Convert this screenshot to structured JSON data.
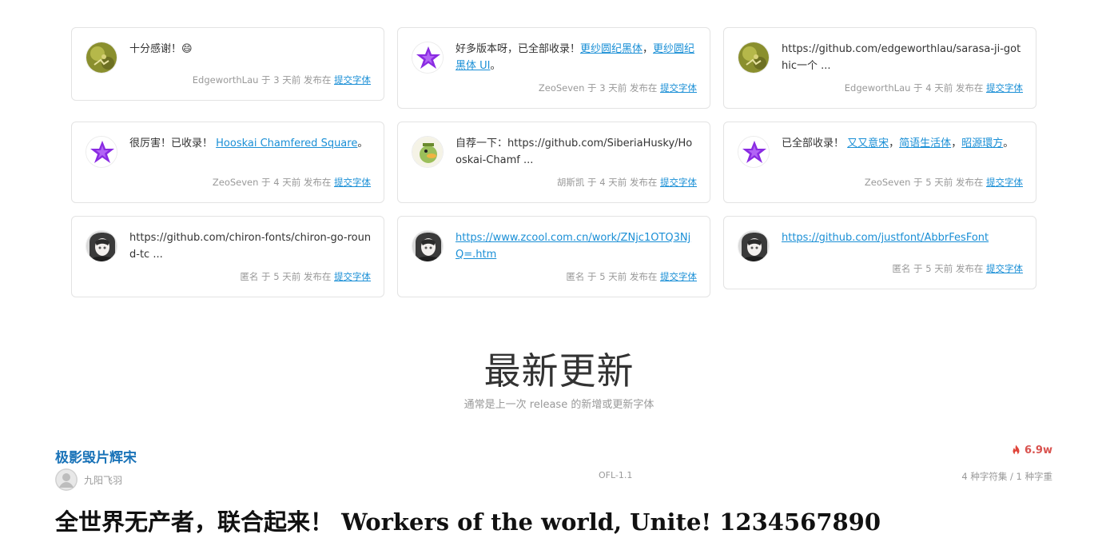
{
  "comments": [
    {
      "avatar": "olive-avatar",
      "message": [
        {
          "text": "十分感谢！😄"
        }
      ],
      "author": "EdgeworthLau",
      "time": "于 3 天前 发布在",
      "link": "提交字体"
    },
    {
      "avatar": "purple-star-avatar",
      "message": [
        {
          "text": "好多版本呀，已全部收录！"
        },
        {
          "text": "更纱圆纪黑体",
          "link": true
        },
        {
          "text": "，"
        },
        {
          "text": "更纱圆纪黑体 UI",
          "link": true
        },
        {
          "text": "。"
        }
      ],
      "author": "ZeoSeven",
      "time": "于 3 天前 发布在",
      "link": "提交字体"
    },
    {
      "avatar": "olive-avatar",
      "message": [
        {
          "text": "https://github.com/edgeworthlau/sarasa-ji-gothic一个 ..."
        }
      ],
      "author": "EdgeworthLau",
      "time": "于 4 天前 发布在",
      "link": "提交字体"
    },
    {
      "avatar": "purple-star-avatar",
      "message": [
        {
          "text": "很厉害！已收录！ "
        },
        {
          "text": "Hooskai Chamfered Square",
          "link": true
        },
        {
          "text": "。"
        }
      ],
      "author": "ZeoSeven",
      "time": "于 4 天前 发布在",
      "link": "提交字体"
    },
    {
      "avatar": "duck-avatar",
      "message": [
        {
          "text": "自荐一下：https://github.com/SiberiaHusky/Hooskai-Chamf ..."
        }
      ],
      "author": "胡斯凯",
      "time": "于 4 天前 发布在",
      "link": "提交字体"
    },
    {
      "avatar": "purple-star-avatar",
      "message": [
        {
          "text": "已全部收录！ "
        },
        {
          "text": "又又意宋",
          "link": true
        },
        {
          "text": "，"
        },
        {
          "text": "简语生活体",
          "link": true
        },
        {
          "text": "，"
        },
        {
          "text": "昭源環方",
          "link": true
        },
        {
          "text": "。"
        }
      ],
      "author": "ZeoSeven",
      "time": "于 5 天前 发布在",
      "link": "提交字体"
    },
    {
      "avatar": "anime-avatar",
      "message": [
        {
          "text": "https://github.com/chiron-fonts/chiron-go-round-tc ..."
        }
      ],
      "author": "匿名",
      "time": "于 5 天前 发布在",
      "link": "提交字体"
    },
    {
      "avatar": "anime-avatar",
      "message": [
        {
          "text": "https://www.zcool.com.cn/work/ZNjc1OTQ3NjQ=.htm",
          "link": true
        }
      ],
      "author": "匿名",
      "time": "于 5 天前 发布在",
      "link": "提交字体"
    },
    {
      "avatar": "anime-avatar",
      "message": [
        {
          "text": "https://github.com/justfont/AbbrFesFont",
          "link": true
        }
      ],
      "author": "匿名",
      "time": "于 5 天前 发布在",
      "link": "提交字体"
    }
  ],
  "section": {
    "title": "最新更新",
    "subtitle": "通常是上一次 release 的新增或更新字体"
  },
  "font_entry": {
    "name": "极影毁片辉宋",
    "author": "九阳飞羽",
    "license": "OFL-1.1",
    "views": "6.9w",
    "charsets": "4 种字符集 / 1 种字重",
    "preview": "全世界无产者，联合起来！  Workers of the world, Unite!  1234567890"
  },
  "colors": {
    "link": "#1a8fd6",
    "title_blue": "#1a73b8",
    "hot": "#d9534f",
    "muted": "#999999"
  }
}
